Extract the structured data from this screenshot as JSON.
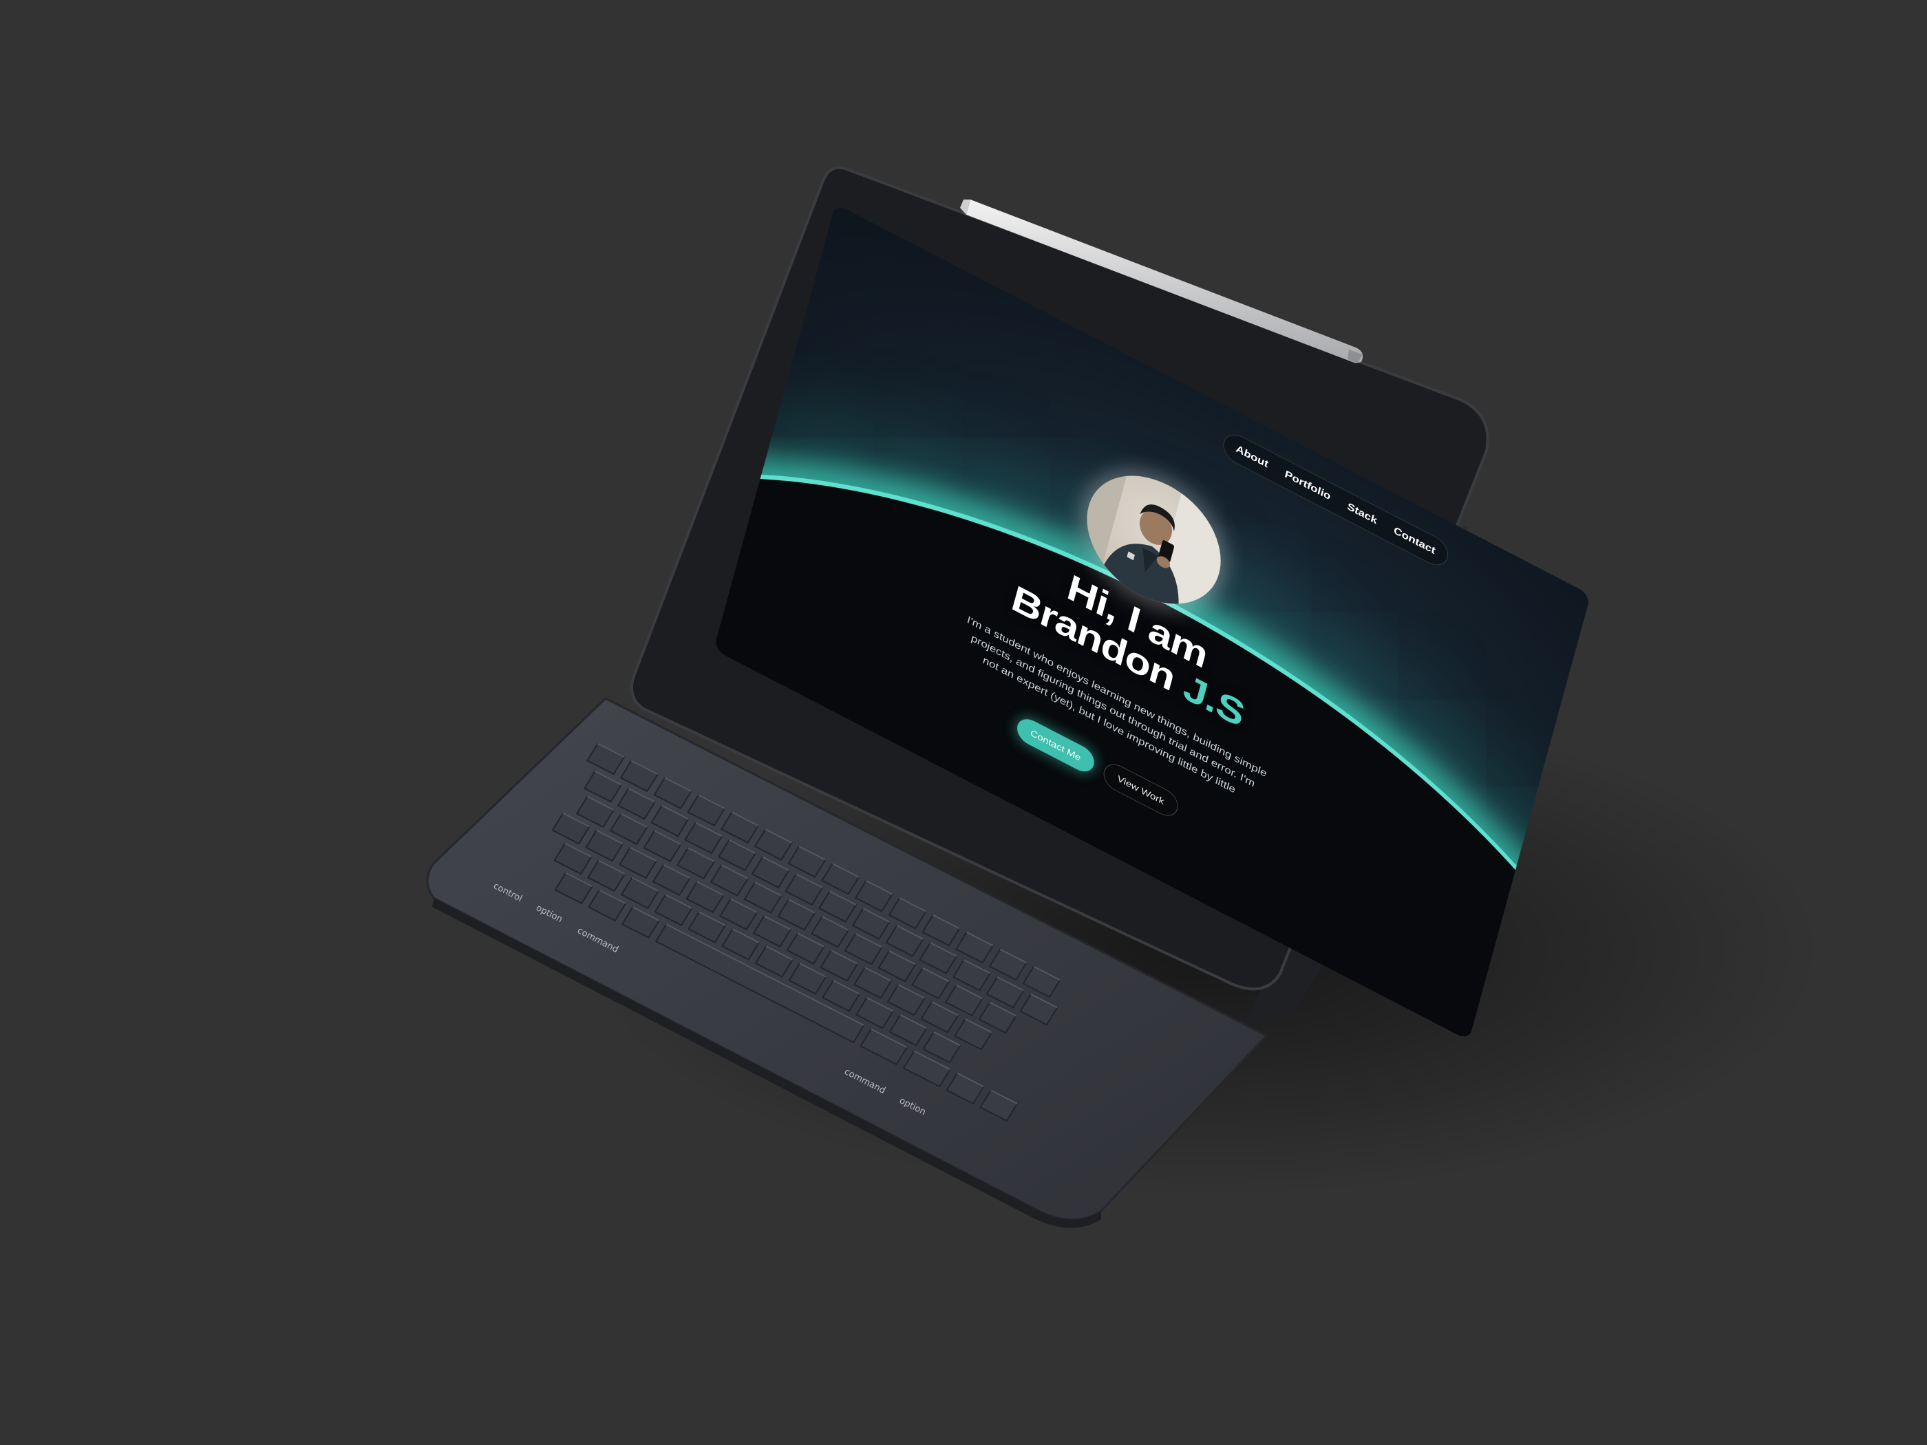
{
  "nav": {
    "items": [
      {
        "label": "About"
      },
      {
        "label": "Portfolio"
      },
      {
        "label": "Stack"
      },
      {
        "label": "Contact"
      }
    ]
  },
  "hero": {
    "greeting": "Hi, I am",
    "first_name": "Brandon",
    "accent_name": "J.S",
    "description": "I'm a student who enjoys learning new things, building simple projects, and figuring things out through trial and error. I'm not an expert (yet), but I love improving little by little",
    "primary_button": "Contact Me",
    "secondary_button": "View Work"
  },
  "keyboard": {
    "mod_labels": [
      "control",
      "option",
      "command",
      "command",
      "option"
    ]
  },
  "colors": {
    "background": "#333333",
    "accent": "#4fd1c1",
    "button": "#3fbfae",
    "device": "#1c1d21",
    "keyboard": "#3a3c44"
  }
}
